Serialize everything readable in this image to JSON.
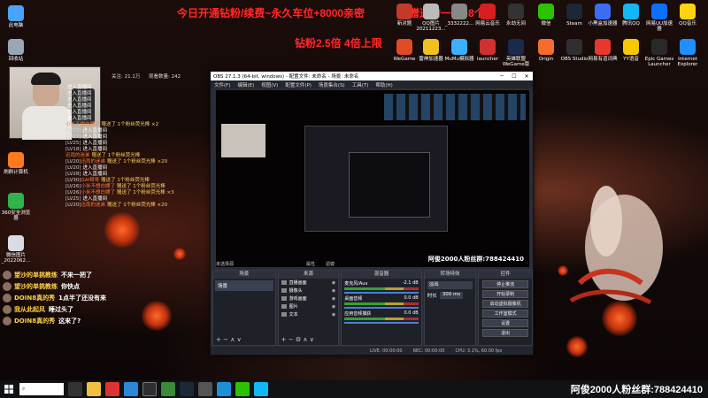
{
  "promo": {
    "line1": "今日开通钻粉/续费~永久车位+8000亲密",
    "line1b": "度赠送的一起+8个",
    "line2": "钻粉2.5倍 4倍上限"
  },
  "desktop_left": [
    {
      "label": "此电脑",
      "icon": "computer-icon",
      "color": "#4aa3ff"
    },
    {
      "label": "回收站",
      "icon": "recycle-bin-icon",
      "color": "#9aa6b2"
    },
    {
      "label": "刷刷计算机",
      "icon": "app-icon",
      "color": "#ff7a1a"
    },
    {
      "label": "360安全浏览器",
      "icon": "browser-icon",
      "color": "#2fb34a"
    },
    {
      "label": "微信图片_2022062...",
      "icon": "image-icon",
      "color": "#d8dde5"
    }
  ],
  "desktop_right": [
    {
      "label": "新对题",
      "icon": "app-icon",
      "color": "#c23a2a"
    },
    {
      "label": "QQ图片20211223...",
      "icon": "image-icon",
      "color": "#bbb"
    },
    {
      "label": "_3332222...",
      "icon": "image-icon",
      "color": "#888"
    },
    {
      "label": "网易云音乐",
      "icon": "music-icon",
      "color": "#d81e1e"
    },
    {
      "label": "永劫无间",
      "icon": "game-icon",
      "color": "#333"
    },
    {
      "label": "微信",
      "icon": "wechat-icon",
      "color": "#2dc100"
    },
    {
      "label": "Steam",
      "icon": "steam-icon",
      "color": "#1b2838"
    },
    {
      "label": "小黑盒加速器",
      "icon": "app-icon",
      "color": "#3a6df0"
    },
    {
      "label": "腾讯QQ",
      "icon": "qq-icon",
      "color": "#12b7f5"
    },
    {
      "label": "网易UU加速器",
      "icon": "app-icon",
      "color": "#0e6fff"
    },
    {
      "label": "QQ音乐",
      "icon": "music-icon",
      "color": "#ffd30f"
    },
    {
      "label": "WeGame",
      "icon": "wegame-icon",
      "color": "#e04a25"
    },
    {
      "label": "雷神加速器",
      "icon": "app-icon",
      "color": "#f0c020"
    },
    {
      "label": "MuMu模拟器",
      "icon": "app-icon",
      "color": "#3ab0ff"
    },
    {
      "label": "launcher",
      "icon": "app-icon",
      "color": "#d03030"
    },
    {
      "label": "英雄联盟WeGame版",
      "icon": "game-icon",
      "color": "#1a2a4a"
    },
    {
      "label": "Origin",
      "icon": "origin-icon",
      "color": "#f56c2d"
    },
    {
      "label": "OBS Studio",
      "icon": "obs-icon",
      "color": "#302e31"
    },
    {
      "label": "网易有道词典",
      "icon": "dict-icon",
      "color": "#e8382d"
    },
    {
      "label": "YY语音",
      "icon": "yy-icon",
      "color": "#f6c800"
    },
    {
      "label": "Epic Games Launcher",
      "icon": "epic-icon",
      "color": "#2a2a2a"
    },
    {
      "label": "Internet Explorer",
      "icon": "ie-icon",
      "color": "#1e90ff"
    }
  ],
  "stream_stats": {
    "fans_label": "关注: 21.1万",
    "viewers_label": "观看数量: 242"
  },
  "chat": [
    {
      "lv": "",
      "name": "",
      "text": "进入直播间"
    },
    {
      "lv": "",
      "name": "",
      "text": "进入直播间"
    },
    {
      "lv": "",
      "name": "",
      "text": "进入直播间"
    },
    {
      "lv": "",
      "name": "",
      "text": "进入直播间"
    },
    {
      "lv": "",
      "name": "",
      "text": "进入直播间"
    },
    {
      "lv": "",
      "name": "",
      "text": "进入直播间"
    },
    {
      "lv": "",
      "name": "小米不想白嫖了",
      "text": "赠送了 1个粉丝荧光棒 ×2"
    },
    {
      "lv": "[LV23]",
      "name": "",
      "text": "进入直播间"
    },
    {
      "lv": "[LV27]",
      "name": "",
      "text": "进入直播间"
    },
    {
      "lv": "[LV25]",
      "name": "",
      "text": "进入直播间"
    },
    {
      "lv": "[LV18]",
      "name": "",
      "text": "进入直播间"
    },
    {
      "lv": "",
      "name": "迅雨的迷弟",
      "text": "赠送了 1个粉丝荧光棒"
    },
    {
      "lv": "[LV20]",
      "name": "迅雨的迷弟",
      "text": "赠送了 1个粉丝荧光棒 ×20"
    },
    {
      "lv": "[LV20]",
      "name": "",
      "text": "进入直播间"
    },
    {
      "lv": "[LV28]",
      "name": "",
      "text": "进入直播间"
    },
    {
      "lv": "[LV30]",
      "name": "GAI哥哥",
      "text": "赠送了 1个粉丝荧光棒"
    },
    {
      "lv": "[LV26]",
      "name": "小米不想白嫖了",
      "text": "赠送了 1个粉丝荧光棒"
    },
    {
      "lv": "[LV26]",
      "name": "小米不想白嫖了",
      "text": "赠送了 1个粉丝荧光棒 ×3"
    },
    {
      "lv": "[LV25]",
      "name": "",
      "text": "进入直播间"
    },
    {
      "lv": "[LV20]",
      "name": "迅雨的迷弟",
      "text": "赠送了 1个粉丝荧光棒 ×20"
    }
  ],
  "bubbles": [
    {
      "user": "望沙的单挑教练",
      "msg": "不来一把了"
    },
    {
      "user": "望沙的单挑教练",
      "msg": "你快点"
    },
    {
      "user": "DOIN8真的秀",
      "msg": "1点半了还没有来"
    },
    {
      "user": "我从此起风",
      "msg": "睡过头了"
    },
    {
      "user": "DOIN8真的秀",
      "msg": "这来了?"
    }
  ],
  "obs": {
    "title": "OBS 27.1.3 (64-bit, windows) - 配置文件: 未命名 - 场景: 未命名",
    "menu": [
      "文件(F)",
      "编辑(E)",
      "视图(V)",
      "配置文件(P)",
      "场景集合(S)",
      "工具(T)",
      "帮助(H)"
    ],
    "watermark": "阿俊2000人粉丝群:788424410",
    "source_bar_label": "未选择源",
    "props_label": "属性",
    "filters_label": "滤镜",
    "panels": {
      "scenes": "场景",
      "sources": "来源",
      "mixer": "混音器",
      "transitions": "转场特效",
      "controls": "控件"
    },
    "scene_item": "场景",
    "sources_list": [
      "直播画面",
      "摄像头",
      "游戏画面",
      "图片",
      "文本"
    ],
    "mixer": [
      {
        "name": "麦克风/Aux",
        "db": "-2.1 dB"
      },
      {
        "name": "桌面音频",
        "db": "0.0 dB"
      },
      {
        "name": "应用音频捕获",
        "db": "0.0 dB"
      }
    ],
    "transition": {
      "type": "淡出",
      "duration_label": "时长",
      "duration": "300 ms"
    },
    "controls": [
      "停止推流",
      "开始录制",
      "启动虚拟摄像机",
      "工作室模式",
      "设置",
      "退出"
    ],
    "status": [
      "LIVE: 00:00:00",
      "REC: 00:00:00",
      "CPU: 3.1%, 60.00 fps"
    ]
  },
  "taskbar": {
    "search_placeholder": "在这里输入你要搜索的内容"
  },
  "bottom_watermark": "阿俊2000人粉丝群:788424410"
}
